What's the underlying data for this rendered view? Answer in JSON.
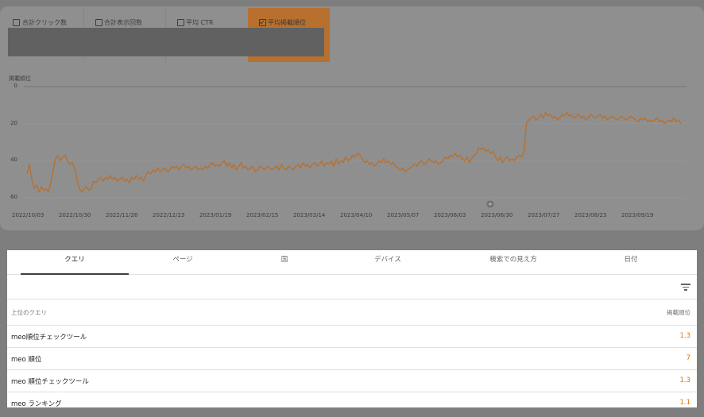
{
  "metric_tabs": [
    {
      "label": "合計クリック数",
      "checked": false
    },
    {
      "label": "合計表示回数",
      "checked": false
    },
    {
      "label": "平均 CTR",
      "checked": false
    },
    {
      "label": "平均掲載順位",
      "checked": true
    }
  ],
  "colors": {
    "accent": "#e37400",
    "line": "#b8702f",
    "active_tab": "#b8702f"
  },
  "chart_data": {
    "type": "line",
    "ylabel": "掲載順位",
    "y_inverted": true,
    "ylim": [
      0,
      60
    ],
    "y_ticks": [
      "0",
      "20",
      "40",
      "60"
    ],
    "x_tick_labels": [
      "2022/10/03",
      "2022/10/30",
      "2022/11/26",
      "2022/12/23",
      "2023/01/19",
      "2023/02/15",
      "2023/03/14",
      "2023/04/10",
      "2023/05/07",
      "2023/06/03",
      "2023/06/30",
      "2023/07/27",
      "2023/08/23",
      "2023/09/19"
    ],
    "grid": true,
    "annotation_marker": "2023/06/26",
    "series": [
      {
        "values": [
          47,
          42,
          50,
          55,
          53,
          57,
          54,
          56,
          55,
          57,
          52,
          45,
          39,
          37,
          40,
          38,
          37,
          40,
          42,
          41,
          44,
          50,
          55,
          57,
          55,
          54,
          56,
          55,
          51,
          52,
          50,
          49,
          51,
          49,
          50,
          48,
          50,
          49,
          51,
          50,
          49,
          51,
          50,
          52,
          49,
          50,
          48,
          50,
          49,
          51,
          48,
          46,
          47,
          45,
          46,
          44,
          46,
          45,
          44,
          46,
          45,
          43,
          44,
          43,
          45,
          43,
          42,
          44,
          43,
          45,
          44,
          43,
          45,
          44,
          45,
          43,
          44,
          42,
          41,
          43,
          42,
          43,
          41,
          40,
          43,
          41,
          44,
          42,
          45,
          43,
          41,
          44,
          43,
          45,
          44,
          43,
          46,
          45,
          43,
          44,
          45,
          43,
          44,
          45,
          44,
          43,
          45,
          42,
          44,
          45,
          43,
          44,
          45,
          43,
          42,
          44,
          41,
          43,
          42,
          44,
          42,
          41,
          43,
          42,
          40,
          43,
          41,
          42,
          40,
          43,
          39,
          42,
          40,
          41,
          38,
          40,
          39,
          37,
          38,
          36,
          37,
          39,
          41,
          40,
          42,
          41,
          43,
          42,
          40,
          41,
          39,
          41,
          40,
          42,
          41,
          43,
          44,
          45,
          44,
          46,
          45,
          44,
          43,
          42,
          43,
          41,
          40,
          42,
          41,
          39,
          40,
          41,
          40,
          42,
          41,
          40,
          38,
          39,
          37,
          38,
          36,
          38,
          37,
          39,
          40,
          38,
          41,
          39,
          37,
          36,
          33,
          34,
          33,
          35,
          34,
          36,
          35,
          38,
          40,
          38,
          41,
          39,
          38,
          40,
          39,
          40,
          38,
          37,
          38,
          35,
          20,
          18,
          17,
          16,
          18,
          17,
          15,
          17,
          14,
          16,
          15,
          17,
          16,
          18,
          17,
          15,
          16,
          14,
          16,
          15,
          17,
          16,
          15,
          17,
          16,
          18,
          17,
          15,
          16,
          17,
          16,
          15,
          17,
          16,
          18,
          17,
          16,
          17,
          18,
          17,
          16,
          17,
          18,
          17,
          16,
          17,
          18,
          19,
          17,
          18,
          17,
          19,
          18,
          19,
          18,
          17,
          19,
          18,
          20,
          19,
          18,
          19,
          17,
          19,
          18,
          20
        ]
      }
    ]
  },
  "table": {
    "tabs": [
      "クエリ",
      "ページ",
      "国",
      "デバイス",
      "検索での見え方",
      "日付"
    ],
    "active_tab": "クエリ",
    "header": {
      "query": "上位のクエリ",
      "metric": "掲載順位"
    },
    "rows": [
      {
        "query": "meo順位チェックツール",
        "value": "1.3"
      },
      {
        "query": "meo 順位",
        "value": "7"
      },
      {
        "query": "meo 順位チェックツール",
        "value": "1.3"
      },
      {
        "query": "meo ランキング",
        "value": "1.1"
      }
    ]
  }
}
